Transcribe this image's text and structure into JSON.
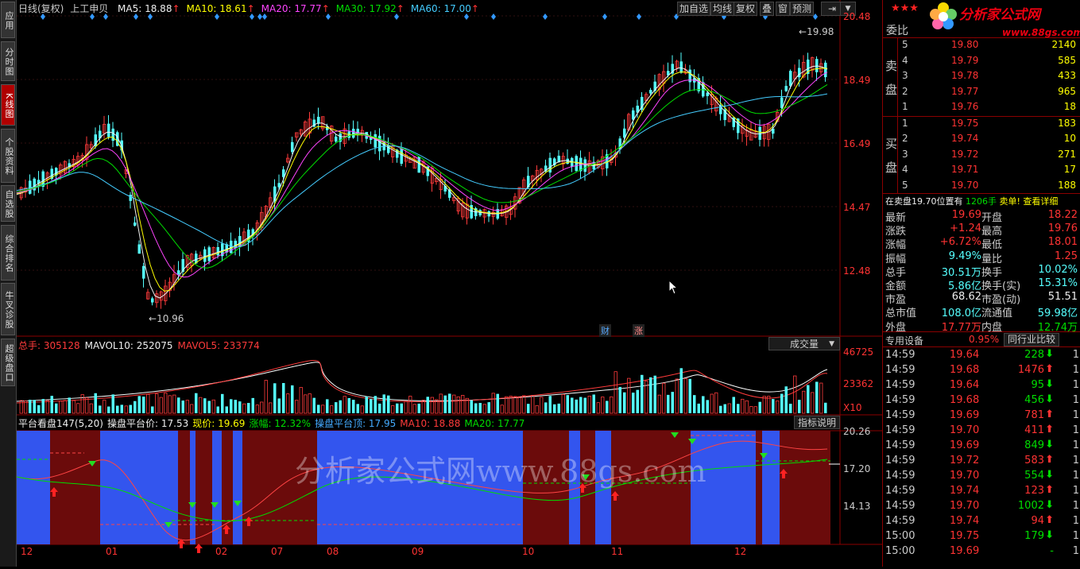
{
  "sidebar": {
    "items": [
      {
        "label": "应用",
        "active": false
      },
      {
        "label": "分时图",
        "active": false
      },
      {
        "label": "K线图",
        "active": true
      },
      {
        "label": "个股资料",
        "active": false
      },
      {
        "label": "自选股",
        "active": false
      },
      {
        "label": "综合排名",
        "active": false
      },
      {
        "label": "牛叉诊股",
        "active": false
      },
      {
        "label": "超级盘口",
        "active": false
      }
    ]
  },
  "main": {
    "period_label": "日线(复权)",
    "stock_name": "上工申贝",
    "ma": [
      {
        "label": "MA5: 18.88",
        "color": "#eeeeee"
      },
      {
        "label": "MA10: 18.61",
        "color": "#ffff00"
      },
      {
        "label": "MA20: 17.77",
        "color": "#ff44ff"
      },
      {
        "label": "MA30: 17.92",
        "color": "#00dd00"
      },
      {
        "label": "MA60: 17.00",
        "color": "#44ccff"
      }
    ],
    "toolbar": [
      "加自选",
      "均线",
      "复权",
      "叠",
      "窗",
      "预测"
    ],
    "price_axis": [
      "20.48",
      "18.49",
      "16.49",
      "14.47",
      "12.48"
    ],
    "high_mark": "19.98",
    "low_mark": "10.96",
    "event_tags": [
      "财",
      "涨"
    ]
  },
  "volume": {
    "legend": [
      {
        "label": "总手: 305128",
        "color": "#ff3b3b"
      },
      {
        "label": "MAVOL10: 252075",
        "color": "#eeeeee"
      },
      {
        "label": "MAVOL5: 233774",
        "color": "#ff3b3b"
      }
    ],
    "selector": "成交量",
    "axis": [
      "46725",
      "23362",
      "X10"
    ]
  },
  "indicator": {
    "legend": [
      {
        "label": "平台看盘147(5,20)",
        "color": "#eeeeee"
      },
      {
        "label": "操盘平台价: 17.53",
        "color": "#eeeeee"
      },
      {
        "label": "现价: 19.69",
        "color": "#ffff00"
      },
      {
        "label": "涨幅: 12.32%",
        "color": "#00dd00"
      },
      {
        "label": "操盘平台顶: 17.95",
        "color": "#44aaff"
      },
      {
        "label": "MA10: 18.88",
        "color": "#ff3b3b"
      },
      {
        "label": "MA20: 17.77",
        "color": "#00dd00"
      }
    ],
    "help": "指标说明",
    "axis": [
      "20.26",
      "17.20",
      "14.13"
    ],
    "months": [
      "12",
      "01",
      "02",
      "07",
      "08",
      "09",
      "10",
      "11",
      "12"
    ],
    "watermark": "分析家公式网www.88gs.com"
  },
  "brand": {
    "title": "分析家公式网",
    "url": "www.88gs.com"
  },
  "quote": {
    "weibi_label": "委比",
    "sell_label": "卖盘",
    "buy_label": "买盘",
    "sell": [
      {
        "n": "5",
        "price": "19.80",
        "vol": "2140"
      },
      {
        "n": "4",
        "price": "19.79",
        "vol": "585"
      },
      {
        "n": "3",
        "price": "19.78",
        "vol": "433"
      },
      {
        "n": "2",
        "price": "19.77",
        "vol": "965"
      },
      {
        "n": "1",
        "price": "19.76",
        "vol": "18"
      }
    ],
    "buy": [
      {
        "n": "1",
        "price": "19.75",
        "vol": "183"
      },
      {
        "n": "2",
        "price": "19.74",
        "vol": "10"
      },
      {
        "n": "3",
        "price": "19.72",
        "vol": "271"
      },
      {
        "n": "4",
        "price": "19.71",
        "vol": "17"
      },
      {
        "n": "5",
        "price": "19.70",
        "vol": "188"
      }
    ],
    "notice": {
      "prefix": "在卖盘19.70位置有",
      "qty": "1206手",
      "tail": "卖单!",
      "link": "查看详细"
    },
    "stats": [
      {
        "l1": "最新",
        "v1": "19.69",
        "c1": "red",
        "l2": "开盘",
        "v2": "18.22",
        "c2": "red"
      },
      {
        "l1": "涨跌",
        "v1": "+1.24",
        "c1": "red",
        "l2": "最高",
        "v2": "19.76",
        "c2": "red"
      },
      {
        "l1": "涨幅",
        "v1": "+6.72%",
        "c1": "red",
        "l2": "最低",
        "v2": "18.01",
        "c2": "red"
      },
      {
        "l1": "振幅",
        "v1": "9.49%",
        "c1": "cyan",
        "l2": "量比",
        "v2": "1.25",
        "c2": "red"
      },
      {
        "l1": "总手",
        "v1": "30.51万",
        "c1": "cyan",
        "l2": "换手",
        "v2": "10.02%",
        "c2": "cyan"
      },
      {
        "l1": "金额",
        "v1": "5.86亿",
        "c1": "cyan",
        "l2": "换手(实)",
        "v2": "15.31%",
        "c2": "cyan"
      },
      {
        "l1": "市盈",
        "v1": "68.62",
        "c1": "white",
        "l2": "市盈(动)",
        "v2": "51.51",
        "c2": "white"
      },
      {
        "l1": "总市值",
        "v1": "108.0亿",
        "c1": "cyan",
        "l2": "流通值",
        "v2": "59.98亿",
        "c2": "cyan"
      },
      {
        "l1": "外盘",
        "v1": "17.77万",
        "c1": "red",
        "l2": "内盘",
        "v2": "12.74万",
        "c2": "green"
      }
    ],
    "industry": "专用设备",
    "industry_pct": "0.95%",
    "compare": "同行业比较",
    "ticks": [
      {
        "t": "14:59",
        "p": "19.64",
        "v": "228",
        "d": "down"
      },
      {
        "t": "14:59",
        "p": "19.68",
        "v": "1476",
        "d": "up"
      },
      {
        "t": "14:59",
        "p": "19.64",
        "v": "95",
        "d": "down"
      },
      {
        "t": "14:59",
        "p": "19.68",
        "v": "456",
        "d": "down"
      },
      {
        "t": "14:59",
        "p": "19.69",
        "v": "781",
        "d": "up"
      },
      {
        "t": "14:59",
        "p": "19.70",
        "v": "411",
        "d": "up"
      },
      {
        "t": "14:59",
        "p": "19.69",
        "v": "849",
        "d": "down"
      },
      {
        "t": "14:59",
        "p": "19.72",
        "v": "583",
        "d": "up"
      },
      {
        "t": "14:59",
        "p": "19.70",
        "v": "554",
        "d": "down"
      },
      {
        "t": "14:59",
        "p": "19.74",
        "v": "123",
        "d": "up"
      },
      {
        "t": "14:59",
        "p": "19.70",
        "v": "1002",
        "d": "down"
      },
      {
        "t": "14:59",
        "p": "19.74",
        "v": "94",
        "d": "up"
      },
      {
        "t": "15:00",
        "p": "19.75",
        "v": "179",
        "d": "down"
      },
      {
        "t": "15:00",
        "p": "19.69",
        "v": "",
        "d": "none"
      }
    ]
  }
}
